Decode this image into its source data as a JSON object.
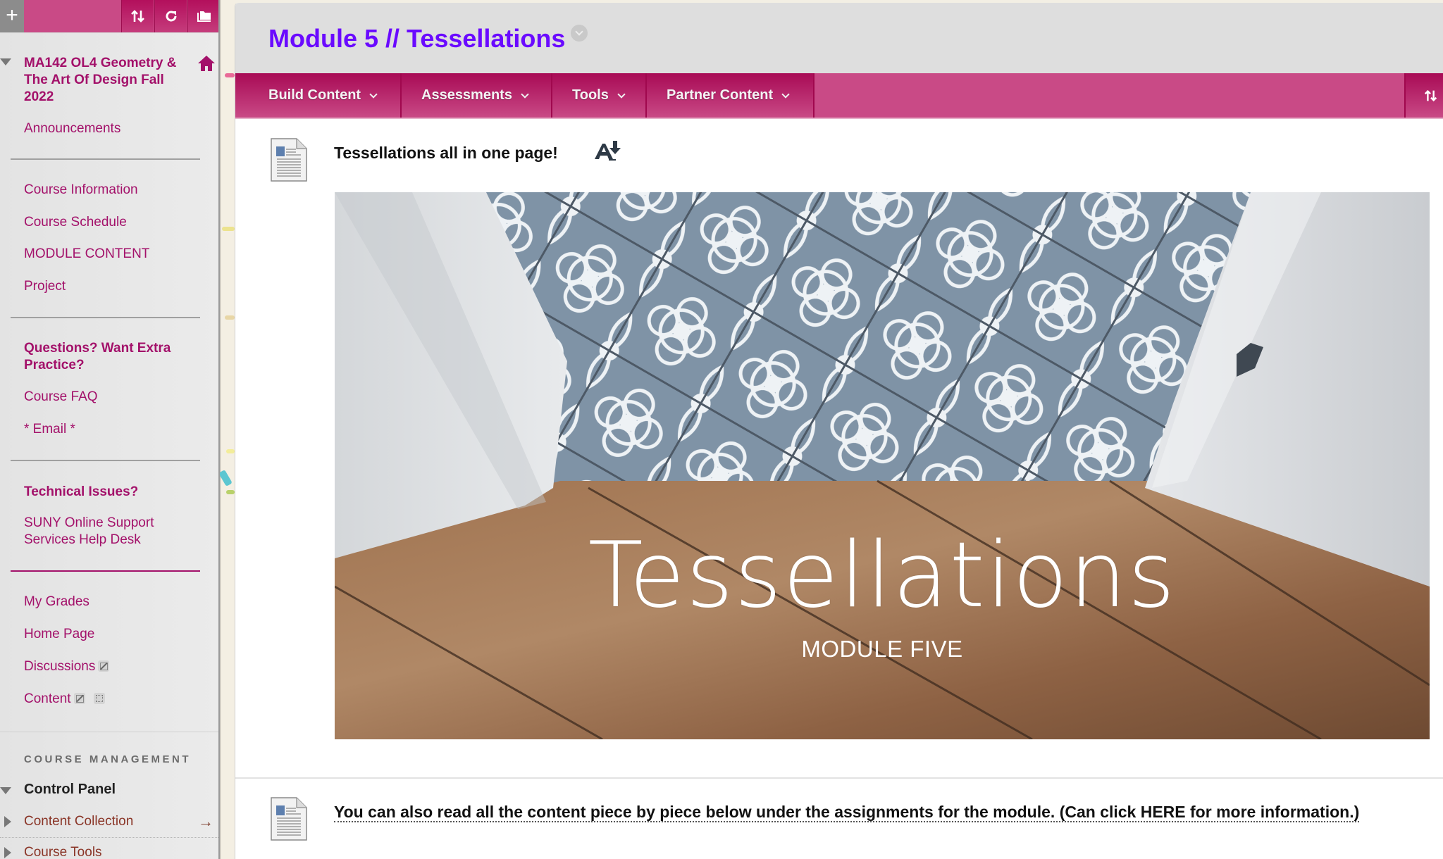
{
  "sidebar": {
    "toolbar": {
      "add_icon": "plus-icon",
      "sort_icon": "sort-arrows-icon",
      "refresh_icon": "refresh-icon",
      "folder_icon": "folder-view-icon"
    },
    "course_title": "MA142 OL4 Geometry & The Art Of Design Fall 2022",
    "home_icon": "home-icon",
    "groups": [
      {
        "items": [
          {
            "label": "Announcements"
          }
        ]
      },
      {
        "items": [
          {
            "label": "Course Information"
          },
          {
            "label": "Course Schedule"
          },
          {
            "label": "MODULE CONTENT"
          },
          {
            "label": "Project"
          }
        ]
      },
      {
        "heading": "Questions? Want Extra Practice?",
        "items": [
          {
            "label": "Course FAQ"
          },
          {
            "label": "* Email *"
          }
        ]
      },
      {
        "heading": "Technical Issues?",
        "items": [
          {
            "label": "SUNY Online Support Services Help Desk"
          }
        ]
      },
      {
        "items": [
          {
            "label": "My Grades"
          },
          {
            "label": "Home Page"
          },
          {
            "label": "Discussions",
            "icons": [
              "hidden-from-students-icon"
            ]
          },
          {
            "label": "Content",
            "icons": [
              "hidden-from-students-icon",
              "empty-area-icon"
            ]
          }
        ]
      }
    ],
    "management": {
      "heading": "COURSE MANAGEMENT",
      "control_panel": "Control Panel",
      "items": [
        {
          "label": "Content Collection",
          "arrow": "→"
        },
        {
          "label": "Course Tools"
        }
      ]
    }
  },
  "header": {
    "title": "Module 5 // Tessellations"
  },
  "menu": {
    "items": [
      {
        "label": "Build Content"
      },
      {
        "label": "Assessments"
      },
      {
        "label": "Tools"
      },
      {
        "label": "Partner Content"
      }
    ],
    "sort_icon": "sort-arrows-icon"
  },
  "content": {
    "items": [
      {
        "title": "Tessellations all in one page!",
        "icon": "document-icon",
        "action_icon": "alternative-formats-icon",
        "banner": {
          "title": "Tessellations",
          "subtitle": "MODULE FIVE"
        }
      },
      {
        "title": "You can also read all the content piece by piece below under the assignments for the module. (Can click HERE for more information.)",
        "icon": "document-icon"
      }
    ]
  },
  "colors": {
    "brand": "#c94a86",
    "brand_dark": "#a80a55",
    "link": "#a3116a",
    "title": "#6a0aff"
  }
}
